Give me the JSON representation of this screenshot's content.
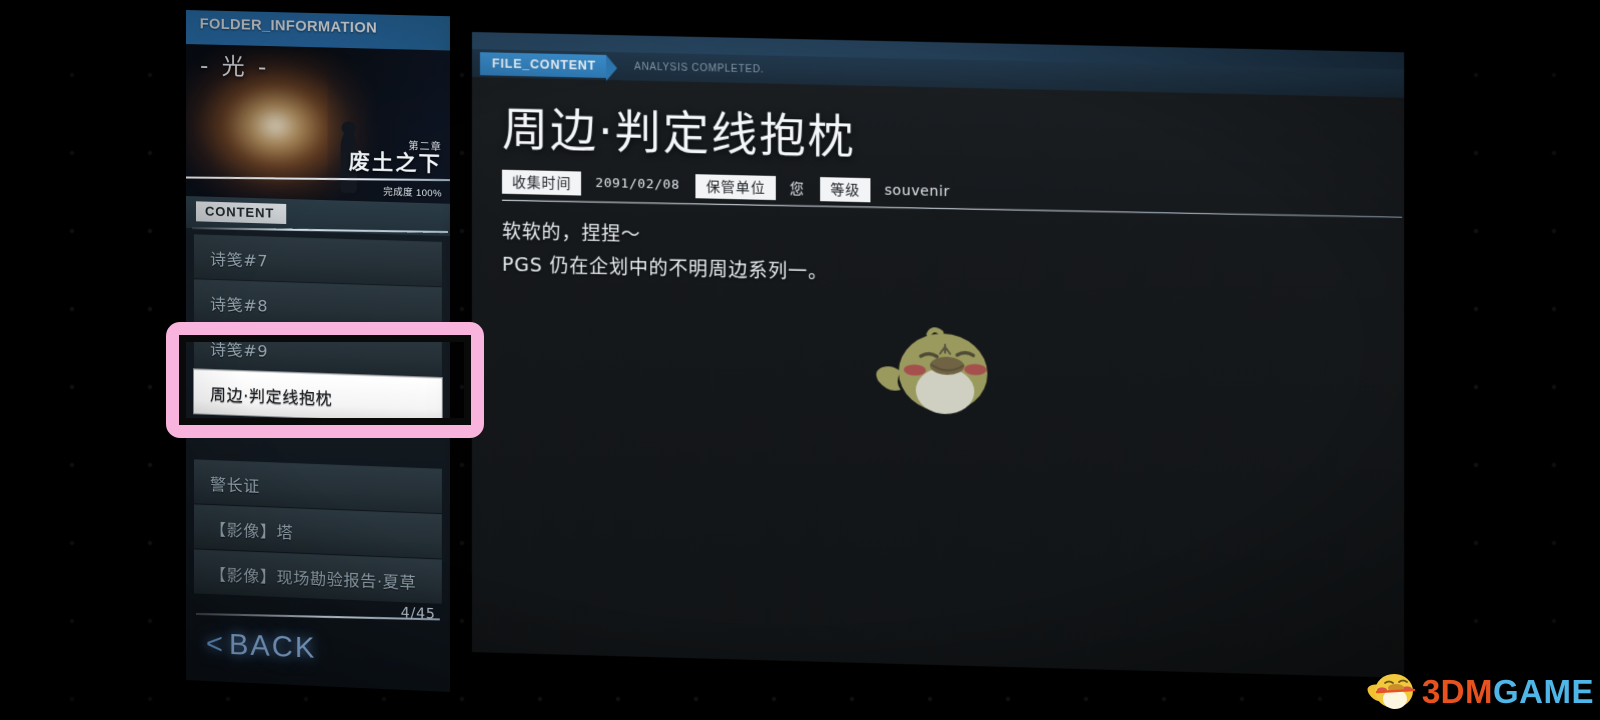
{
  "sidebar": {
    "title": "FOLDER_INFORMATION",
    "folder": {
      "handwritten_title": "- 光 -",
      "chapter_label": "第二章",
      "chapter_name": "废土之下",
      "completion": "完成度 100%"
    },
    "content_header": "CONTENT",
    "items": [
      {
        "label": "诗笺#7",
        "selected": false
      },
      {
        "label": "诗笺#8",
        "selected": false
      },
      {
        "label": "诗笺#9",
        "selected": false
      },
      {
        "label": "周边·判定线抱枕",
        "selected": true
      },
      {
        "label": "",
        "selected": false
      },
      {
        "label": "警长证",
        "selected": false
      },
      {
        "label": "【影像】塔",
        "selected": false
      },
      {
        "label": "【影像】现场勘验报告·夏草",
        "selected": false
      }
    ],
    "page_indicator": "4/45",
    "back_arrow": "<",
    "back_label": "BACK"
  },
  "main": {
    "tag": "FILE_CONTENT",
    "status": "ANALYSIS COMPLETED.",
    "title": "周边·判定线抱枕",
    "meta": [
      {
        "key": "收集时间",
        "value": "2091/02/08"
      },
      {
        "key": "保管单位",
        "value": "您"
      },
      {
        "key": "等级",
        "value": "souvenir"
      }
    ],
    "description_lines": [
      "软软的，捏捏～",
      "PGS 仍在企划中的不明周边系列一。"
    ],
    "illustration": "chick-pillow-illustration"
  },
  "watermark": {
    "text_orange": "3DM",
    "text_blue": "GAME",
    "mascot": "chick-mascot-icon"
  },
  "colors": {
    "accent_blue": "#2f79b4",
    "title_bar_blue": "#2f7fc4",
    "selected_item_bg": "#ffffff",
    "highlight_pink": "#f9b4dd",
    "pillow_body": "#9a9a5e",
    "watermark_orange": "#e8521f",
    "watermark_blue": "#4fb6e8"
  },
  "annotation": {
    "type": "selection-highlight-box",
    "target": "周边·判定线抱枕"
  }
}
